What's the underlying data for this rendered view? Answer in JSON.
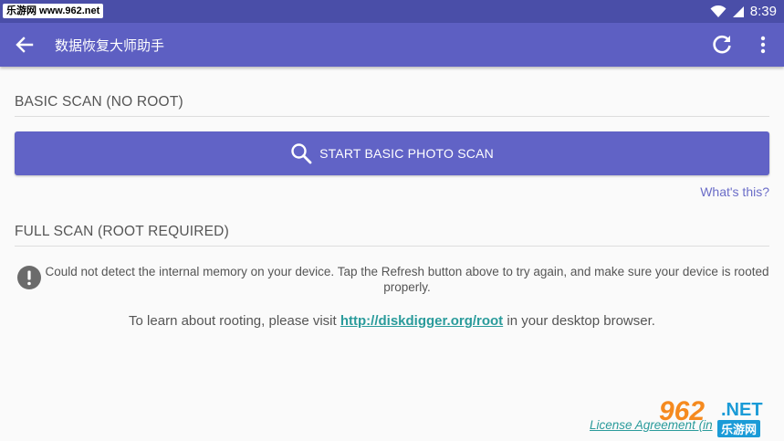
{
  "status_bar": {
    "watermark": "乐游网 www.962.net",
    "time": "8:39"
  },
  "toolbar": {
    "title": "数据恢复大师助手",
    "icons": [
      "arrow-back-icon",
      "refresh-icon",
      "more-vert-icon"
    ]
  },
  "basic_scan": {
    "header": "BASIC SCAN (NO ROOT)",
    "button_label": "START BASIC PHOTO SCAN",
    "whats_this": "What's this?"
  },
  "full_scan": {
    "header": "FULL SCAN (ROOT REQUIRED)",
    "warning": "Could not detect the internal memory on your device. Tap the Refresh button above to try again, and make sure your device is rooted properly.",
    "learn_prefix": "To learn about rooting, please visit ",
    "learn_link": "http://diskdigger.org/root",
    "learn_suffix": " in your desktop browser."
  },
  "footer": {
    "license_link": "License Agreement (in",
    "watermark_num": "962",
    "watermark_net": ".NET",
    "watermark_cn": "乐游网"
  },
  "colors": {
    "status_bar": "#4a4ea8",
    "toolbar": "#5d5fc2",
    "button": "#6163c6",
    "link": "#2a9b9b"
  }
}
